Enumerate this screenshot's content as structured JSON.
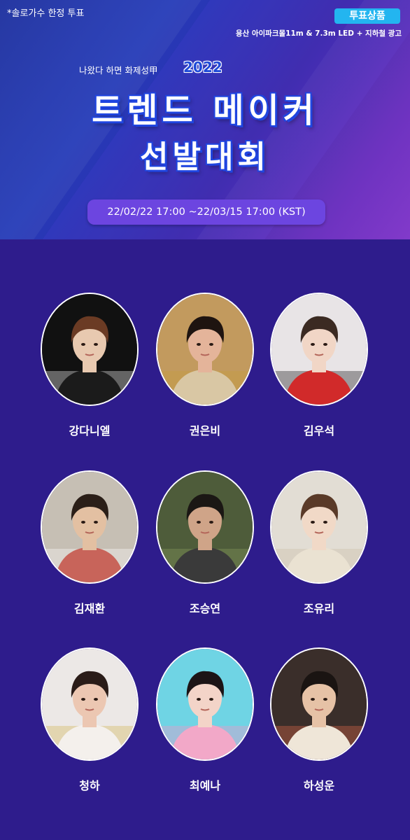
{
  "header": {
    "note": "*솔로가수 한정 투표",
    "prize_badge": "투표상품",
    "prize_text": "용산 아이파크몰11m & 7.3m LED + 지하철 광고",
    "subtitle": "나왔다 하면 화제성甲",
    "year": "2022",
    "title_line1": "트렌드 메이커",
    "title_line2": "선발대회",
    "date_range": "22/02/22 17:00 ~22/03/15 17:00 (KST)"
  },
  "candidates": [
    {
      "name": "강다니엘",
      "bg": "#111111",
      "skin": "#e8c9b0",
      "hair": "#6b3b24",
      "cloth": "#1b1b1b",
      "accent": "#ffffff"
    },
    {
      "name": "권은비",
      "bg": "#c29a5e",
      "skin": "#e4b49a",
      "hair": "#1e1410",
      "cloth": "#d9c7a4",
      "accent": "#c69d3a"
    },
    {
      "name": "김우석",
      "bg": "#e8e4e6",
      "skin": "#f1d6c6",
      "hair": "#3b2a22",
      "cloth": "#d12a2a",
      "accent": "#111111"
    },
    {
      "name": "김재환",
      "bg": "#c6bfb4",
      "skin": "#e3c0a2",
      "hair": "#2b1f18",
      "cloth": "#c8645a",
      "accent": "#ffffff"
    },
    {
      "name": "조승연",
      "bg": "#4e5c3a",
      "skin": "#cfa488",
      "hair": "#1b1714",
      "cloth": "#3a3a3a",
      "accent": "#8b9f62"
    },
    {
      "name": "조유리",
      "bg": "#e2ddd4",
      "skin": "#f1d9c7",
      "hair": "#5a3a28",
      "cloth": "#eae2d2",
      "accent": "#c9b9a2"
    },
    {
      "name": "청하",
      "bg": "#ece8e6",
      "skin": "#ecc7b2",
      "hair": "#2a1c18",
      "cloth": "#f4f0ec",
      "accent": "#d0b24a"
    },
    {
      "name": "최예나",
      "bg": "#6fd4e4",
      "skin": "#f3d4c8",
      "hair": "#1c1416",
      "cloth": "#f2a8c8",
      "accent": "#ff8fc6"
    },
    {
      "name": "하성운",
      "bg": "#3a2e2a",
      "skin": "#e6c2a6",
      "hair": "#1a1412",
      "cloth": "#efe6d8",
      "accent": "#e86a4a"
    }
  ]
}
